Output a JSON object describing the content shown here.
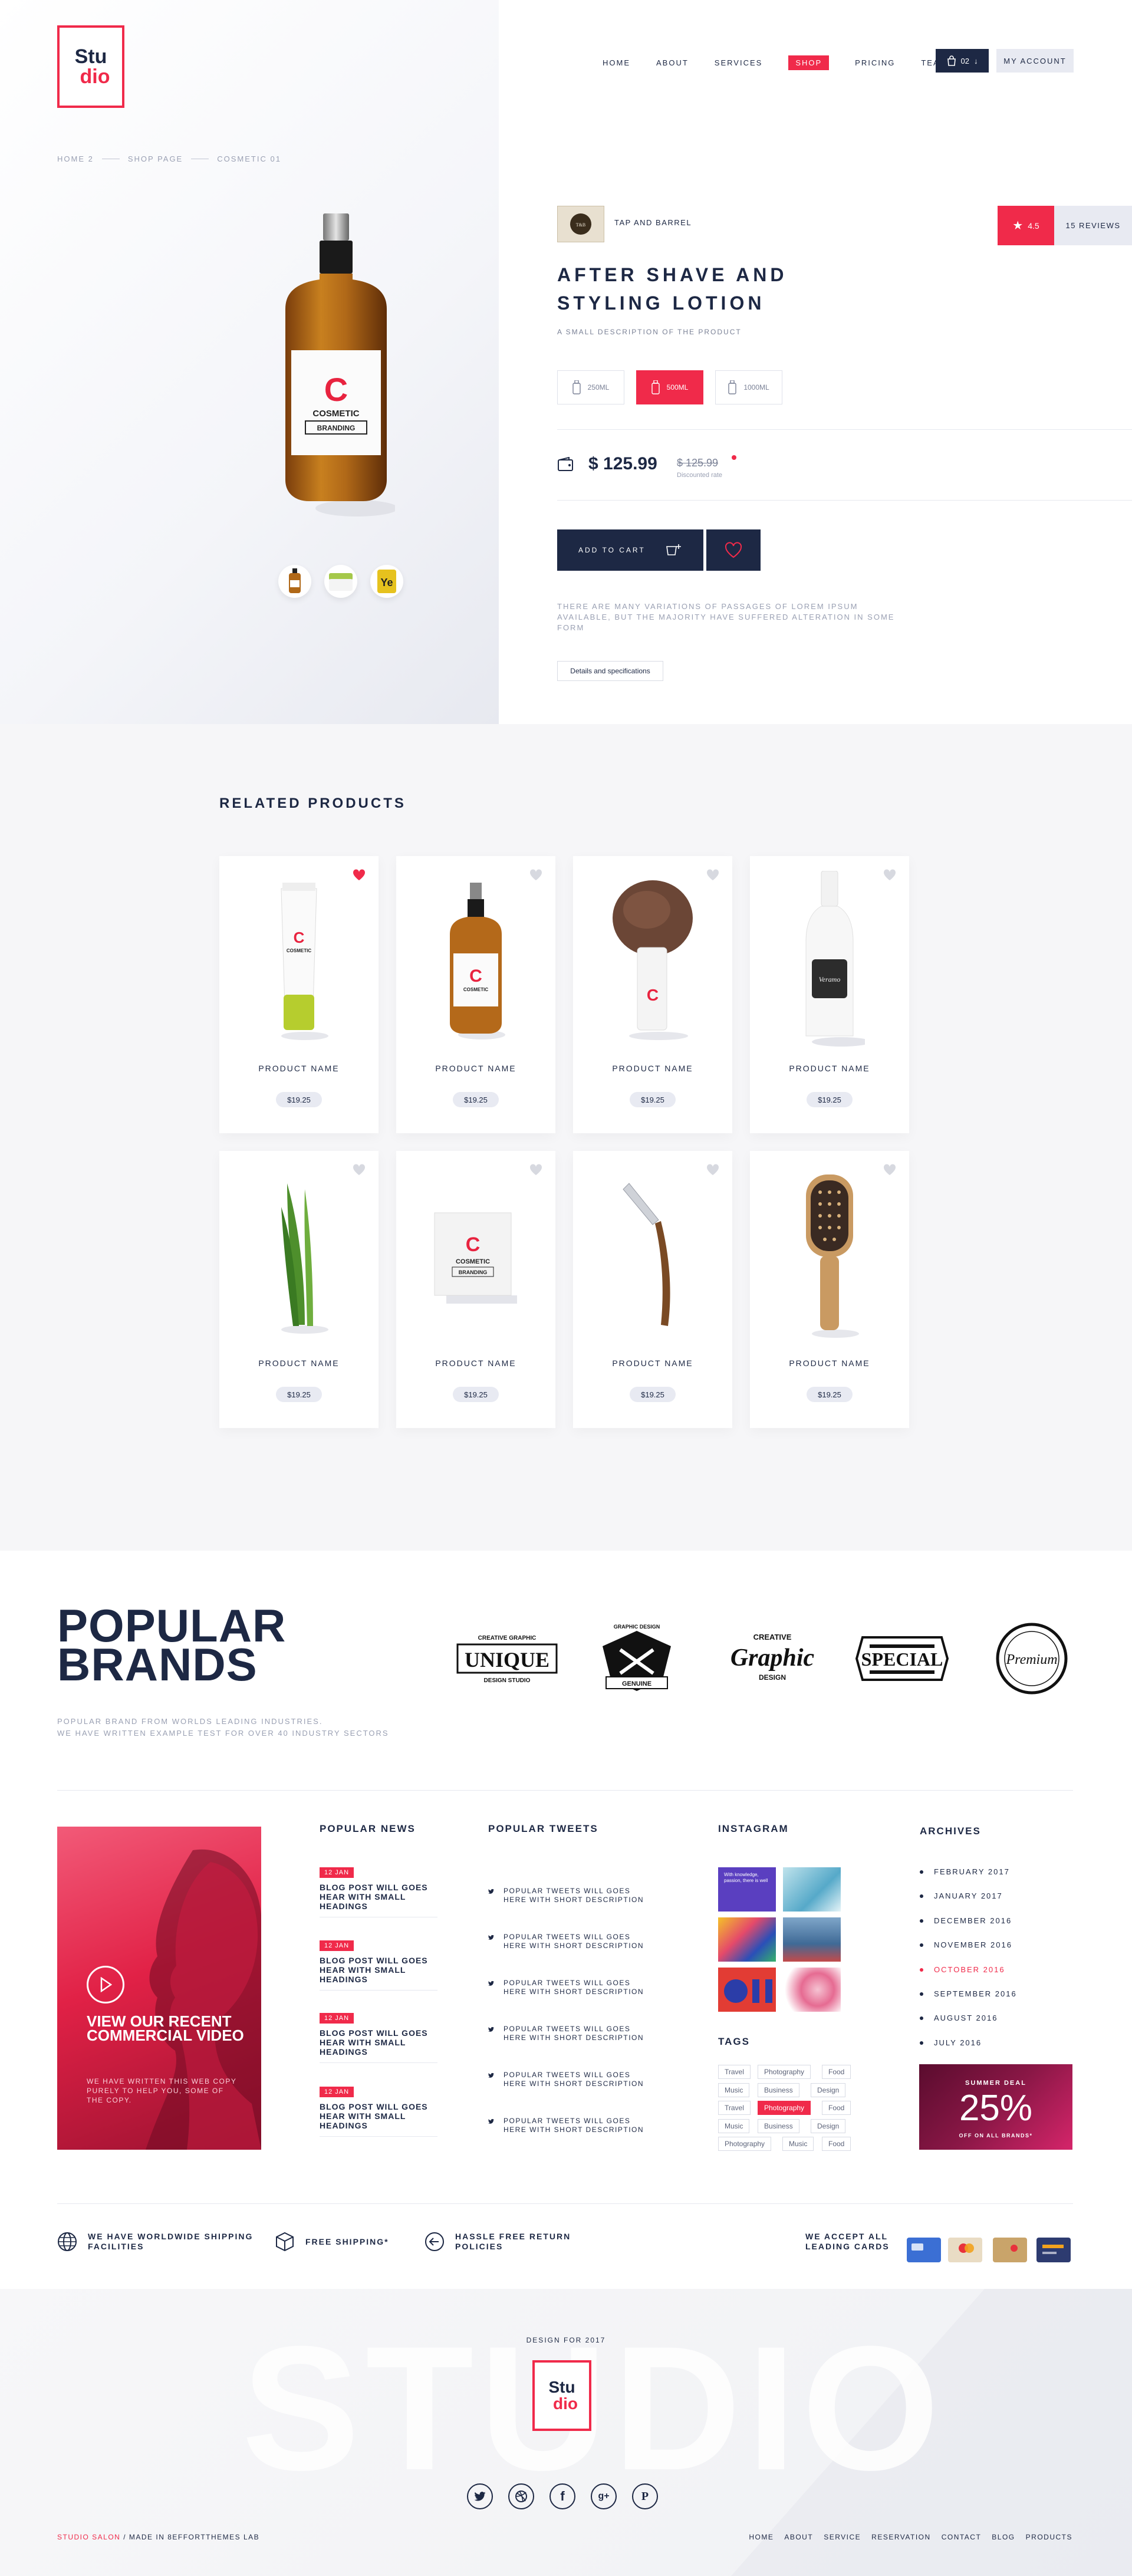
{
  "logo": {
    "line1": "Stu",
    "line2": "dio"
  },
  "nav": {
    "items": [
      "HOME",
      "ABOUT",
      "SERVICES",
      "SHOP",
      "PRICING",
      "TEAM"
    ],
    "active": "SHOP",
    "cart_count": "02",
    "account_label": "MY ACCOUNT"
  },
  "breadcrumb": [
    "HOME 2",
    "SHOP PAGE",
    "COSMETIC 01"
  ],
  "product": {
    "brand_name": "TAP AND BARREL",
    "rating": "4.5",
    "reviews": "15 REVIEWS",
    "title": "AFTER SHAVE AND STYLING LOTION",
    "short_desc": "A SMALL DESCRIPTION OF THE PRODUCT",
    "sizes": [
      "250ML",
      "500ML",
      "1000ML"
    ],
    "active_size": "500ML",
    "price": "$ 125.99",
    "old_price": "$ 125.99",
    "discount_label": "Discounted rate",
    "add_to_cart": "ADD TO CART",
    "variations_text": "THERE ARE MANY VARIATIONS OF PASSAGES OF LOREM IPSUM AVAILABLE, BUT THE MAJORITY HAVE SUFFERED ALTERATION IN SOME FORM",
    "details_label": "Details and specifications",
    "label_c": "C",
    "label_text1": "COSMETIC",
    "label_text2": "BRANDING"
  },
  "related": {
    "title": "RELATED PRODUCTS",
    "products": [
      {
        "name": "PRODUCT NAME",
        "price": "$19.25",
        "icon": "tube",
        "liked": true
      },
      {
        "name": "PRODUCT NAME",
        "price": "$19.25",
        "icon": "bottle",
        "liked": false
      },
      {
        "name": "PRODUCT NAME",
        "price": "$19.25",
        "icon": "brush",
        "liked": false
      },
      {
        "name": "PRODUCT NAME",
        "price": "$19.25",
        "icon": "white-bottle",
        "liked": false
      },
      {
        "name": "PRODUCT NAME",
        "price": "$19.25",
        "icon": "aloe",
        "liked": false
      },
      {
        "name": "PRODUCT NAME",
        "price": "$19.25",
        "icon": "box",
        "liked": false
      },
      {
        "name": "PRODUCT NAME",
        "price": "$19.25",
        "icon": "razor",
        "liked": false
      },
      {
        "name": "PRODUCT NAME",
        "price": "$19.25",
        "icon": "hairbrush",
        "liked": false
      }
    ]
  },
  "brands": {
    "title_line1": "POPULAR",
    "title_line2": "BRANDS",
    "desc_line1": "POPULAR BRAND FROM WORLDS LEADING INDUSTRIES.",
    "desc_line2": "WE HAVE WRITTEN EXAMPLE TEST FOR OVER 40 INDUSTRY SECTORS",
    "logos": [
      {
        "top": "CREATIVE GRAPHIC",
        "main": "UNIQUE",
        "bottom": "DESIGN STUDIO"
      },
      {
        "top": "GRAPHIC DESIGN",
        "main": "GENUINE",
        "bottom": ""
      },
      {
        "top": "CREATIVE",
        "main": "Graphic",
        "bottom": "DESIGN"
      },
      {
        "top": "",
        "main": "SPECIAL",
        "bottom": ""
      },
      {
        "top": "",
        "main": "Premium",
        "bottom": ""
      }
    ]
  },
  "video": {
    "title": "VIEW OUR RECENT COMMERCIAL VIDEO",
    "desc": "WE HAVE WRITTEN THIS WEB COPY PURELY TO HELP YOU, SOME OF THE COPY."
  },
  "news": {
    "title": "POPULAR NEWS",
    "items": [
      {
        "date": "12 JAN",
        "title": "BLOG POST WILL GOES HEAR WITH SMALL HEADINGS"
      },
      {
        "date": "12 JAN",
        "title": "BLOG POST WILL GOES HEAR WITH SMALL HEADINGS"
      },
      {
        "date": "12 JAN",
        "title": "BLOG POST WILL GOES HEAR WITH SMALL HEADINGS"
      },
      {
        "date": "12 JAN",
        "title": "BLOG POST WILL GOES HEAR WITH SMALL HEADINGS"
      }
    ]
  },
  "tweets": {
    "title": "POPULAR TWEETS",
    "items": [
      "POPULAR TWEETS WILL GOES HERE WITH SHORT DESCRIPTION",
      "POPULAR TWEETS WILL GOES HERE WITH SHORT DESCRIPTION",
      "POPULAR TWEETS WILL GOES HERE WITH SHORT DESCRIPTION",
      "POPULAR TWEETS WILL GOES HERE WITH SHORT DESCRIPTION",
      "POPULAR TWEETS WILL GOES HERE WITH SHORT DESCRIPTION",
      "POPULAR TWEETS WILL GOES HERE WITH SHORT DESCRIPTION"
    ]
  },
  "instagram": {
    "title": "INSTAGRAM",
    "first_caption": "With knowledge, passion, there is well"
  },
  "tags": {
    "title": "TAGS",
    "items": [
      "Travel",
      "Photography",
      "Food",
      "Music",
      "Business",
      "Design",
      "Travel",
      "Photography",
      "Food",
      "Music",
      "Business",
      "Design",
      "Photography",
      "Music",
      "Food"
    ],
    "active_index": 7
  },
  "archives": {
    "title": "ARCHIVES",
    "items": [
      "FEBRUARY 2017",
      "JANUARY 2017",
      "DECEMBER 2016",
      "NOVEMBER 2016",
      "OCTOBER 2016",
      "SEPTEMBER 2016",
      "AUGUST 2016",
      "JULY 2016"
    ],
    "active": "OCTOBER 2016"
  },
  "deal": {
    "label": "SUMMER DEAL",
    "value": "25%",
    "sub": "OFF ON ALL BRANDS*"
  },
  "features": {
    "shipping": "WE HAVE WORLDWIDE SHIPPING FACILITIES",
    "free_shipping": "FREE SHIPPING*",
    "returns": "HASSLE FREE RETURN POLICIES",
    "cards": "WE ACCEPT ALL LEADING CARDS"
  },
  "footer": {
    "big_text": "STUDIO",
    "design_for": "DESIGN FOR 2017",
    "copyright_brand": "STUDIO SALON",
    "copyright_rest": " / MADE IN 8EFFORTTHEMES LAB",
    "nav": [
      "HOME",
      "ABOUT",
      "SERVICE",
      "RESERVATION",
      "CONTACT",
      "BLOG",
      "PRODUCTS"
    ]
  },
  "colors": {
    "navy": "#1d2844",
    "accent": "#f02a4a",
    "light": "#e8eaf2"
  }
}
